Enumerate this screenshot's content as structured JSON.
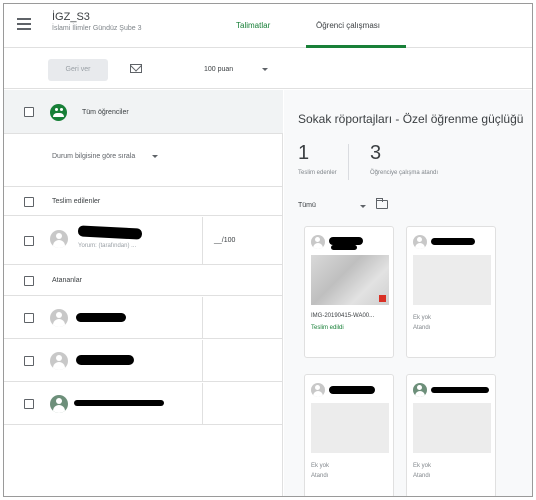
{
  "header": {
    "class_title": "İGZ_S3",
    "class_subtitle": "İslami İlimler Gündüz Şube 3",
    "tabs": [
      {
        "label": "Talimatlar",
        "active": false
      },
      {
        "label": "Öğrenci çalışması",
        "active": true
      }
    ],
    "accent_color": "#188038"
  },
  "toolbar": {
    "return_label": "Geri ver",
    "points": "100 puan"
  },
  "list": {
    "all_students_label": "Tüm öğrenciler",
    "sort_label": "Durum bilgisine göre sırala",
    "turned_in_section": "Teslim edilenler",
    "assigned_section": "Atananlar",
    "turned_in_students": [
      {
        "comment": "Yorum: (tarafından) ...",
        "grade": "__/100"
      }
    ]
  },
  "assignment": {
    "title": "Sokak röportajları - Özel öğrenme güçlüğü",
    "turned_in_count": "1",
    "turned_in_label": "Teslim edenler",
    "assigned_count": "3",
    "assigned_label": "Öğrenciye çalışma atandı",
    "filter_label": "Tümü"
  },
  "cards": [
    {
      "file_name": "IMG-20190415-WA00...",
      "status": "Teslim edildi"
    },
    {
      "file_name": "",
      "status": "Ek yok",
      "status2": "Atandı"
    },
    {
      "file_name": "",
      "status": "Ek yok",
      "status2": "Atandı"
    },
    {
      "file_name": "",
      "status": "Ek yok",
      "status2": "Atandı"
    }
  ]
}
